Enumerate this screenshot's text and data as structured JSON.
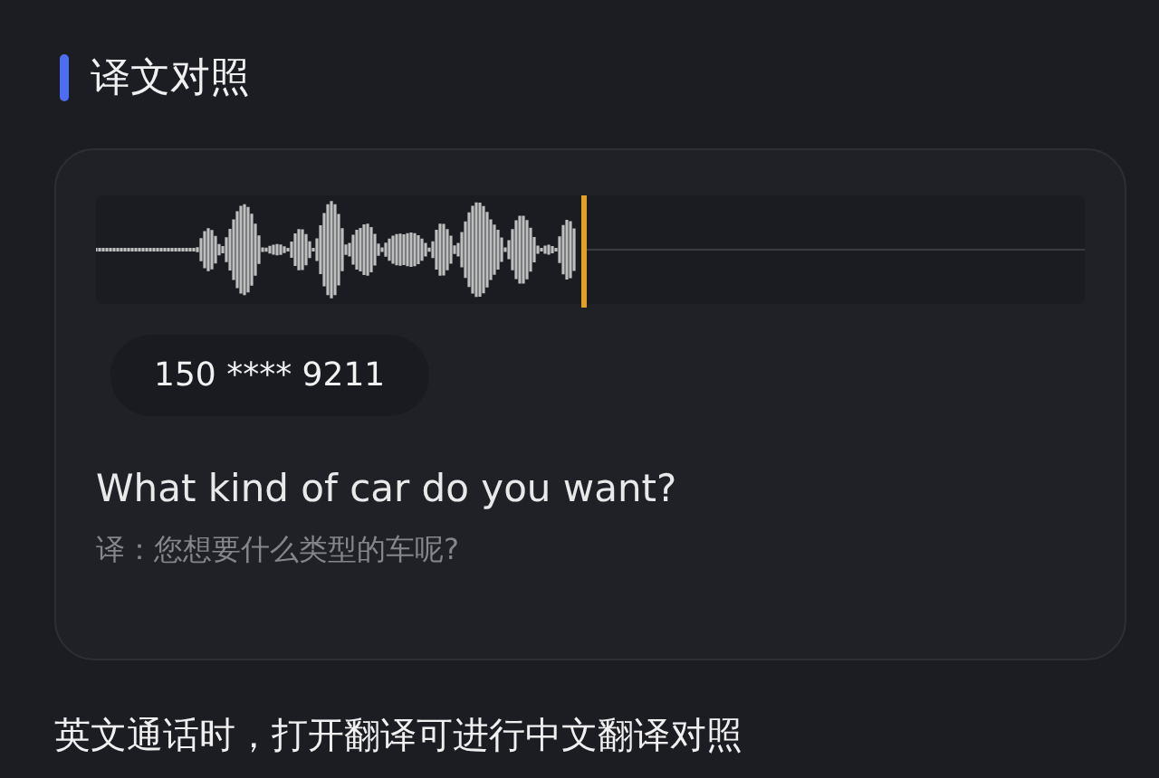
{
  "section_title": "译文对照",
  "card": {
    "playback": {
      "level": 0.49
    },
    "caller": "150 **** 9211",
    "original": "What kind of car do you want?",
    "translation": "译：您想要什么类型的车呢?"
  },
  "note": "英文通话时，打开翻译可进行中文翻译对照"
}
